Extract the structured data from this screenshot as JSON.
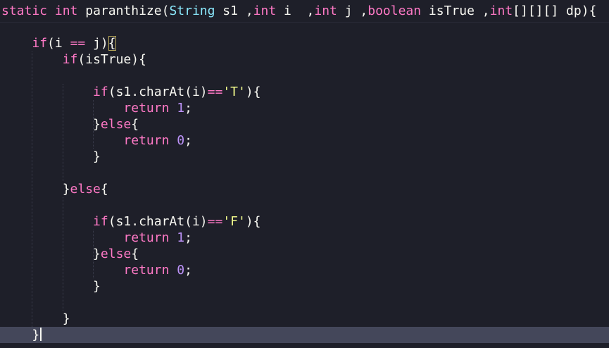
{
  "editor": {
    "theme_colors": {
      "background": "#1e1f29",
      "current_line": "#44475a",
      "keyword": "#ff79c6",
      "type": "#8be9fd",
      "number": "#bd93f9",
      "string": "#f1fa8c",
      "text": "#f8f8f2"
    },
    "current_line_index": 20,
    "lines": [
      {
        "tokens": [
          {
            "t": "kw",
            "v": "static"
          },
          {
            "t": "plain",
            "v": " "
          },
          {
            "t": "kw",
            "v": "int"
          },
          {
            "t": "plain",
            "v": " paranthize("
          },
          {
            "t": "type",
            "v": "String"
          },
          {
            "t": "plain",
            "v": " s1 ,"
          },
          {
            "t": "kw",
            "v": "int"
          },
          {
            "t": "plain",
            "v": " i  ,"
          },
          {
            "t": "kw",
            "v": "int"
          },
          {
            "t": "plain",
            "v": " j ,"
          },
          {
            "t": "kw",
            "v": "boolean"
          },
          {
            "t": "plain",
            "v": " isTrue ,"
          },
          {
            "t": "kw",
            "v": "int"
          },
          {
            "t": "plain",
            "v": "[][][] dp){"
          }
        ]
      },
      {
        "tokens": []
      },
      {
        "tokens": [
          {
            "t": "plain",
            "v": "    "
          },
          {
            "t": "kw",
            "v": "if"
          },
          {
            "t": "plain",
            "v": "(i "
          },
          {
            "t": "op",
            "v": "=="
          },
          {
            "t": "plain",
            "v": " j)"
          },
          {
            "t": "bracket-hl",
            "v": "{"
          }
        ]
      },
      {
        "tokens": [
          {
            "t": "plain",
            "v": "        "
          },
          {
            "t": "kw",
            "v": "if"
          },
          {
            "t": "plain",
            "v": "(isTrue){"
          }
        ]
      },
      {
        "tokens": []
      },
      {
        "tokens": [
          {
            "t": "plain",
            "v": "            "
          },
          {
            "t": "kw",
            "v": "if"
          },
          {
            "t": "plain",
            "v": "(s1.charAt(i)"
          },
          {
            "t": "op",
            "v": "=="
          },
          {
            "t": "str",
            "v": "'T'"
          },
          {
            "t": "plain",
            "v": "){"
          }
        ]
      },
      {
        "tokens": [
          {
            "t": "plain",
            "v": "                "
          },
          {
            "t": "kw",
            "v": "return"
          },
          {
            "t": "plain",
            "v": " "
          },
          {
            "t": "num",
            "v": "1"
          },
          {
            "t": "plain",
            "v": ";"
          }
        ]
      },
      {
        "tokens": [
          {
            "t": "plain",
            "v": "            }"
          },
          {
            "t": "kw",
            "v": "else"
          },
          {
            "t": "plain",
            "v": "{"
          }
        ]
      },
      {
        "tokens": [
          {
            "t": "plain",
            "v": "                "
          },
          {
            "t": "kw",
            "v": "return"
          },
          {
            "t": "plain",
            "v": " "
          },
          {
            "t": "num",
            "v": "0"
          },
          {
            "t": "plain",
            "v": ";"
          }
        ]
      },
      {
        "tokens": [
          {
            "t": "plain",
            "v": "            }"
          }
        ]
      },
      {
        "tokens": []
      },
      {
        "tokens": [
          {
            "t": "plain",
            "v": "        }"
          },
          {
            "t": "kw",
            "v": "else"
          },
          {
            "t": "plain",
            "v": "{"
          }
        ]
      },
      {
        "tokens": []
      },
      {
        "tokens": [
          {
            "t": "plain",
            "v": "            "
          },
          {
            "t": "kw",
            "v": "if"
          },
          {
            "t": "plain",
            "v": "(s1.charAt(i)"
          },
          {
            "t": "op",
            "v": "=="
          },
          {
            "t": "str",
            "v": "'F'"
          },
          {
            "t": "plain",
            "v": "){"
          }
        ]
      },
      {
        "tokens": [
          {
            "t": "plain",
            "v": "                "
          },
          {
            "t": "kw",
            "v": "return"
          },
          {
            "t": "plain",
            "v": " "
          },
          {
            "t": "num",
            "v": "1"
          },
          {
            "t": "plain",
            "v": ";"
          }
        ]
      },
      {
        "tokens": [
          {
            "t": "plain",
            "v": "            }"
          },
          {
            "t": "kw",
            "v": "else"
          },
          {
            "t": "plain",
            "v": "{"
          }
        ]
      },
      {
        "tokens": [
          {
            "t": "plain",
            "v": "                "
          },
          {
            "t": "kw",
            "v": "return"
          },
          {
            "t": "plain",
            "v": " "
          },
          {
            "t": "num",
            "v": "0"
          },
          {
            "t": "plain",
            "v": ";"
          }
        ]
      },
      {
        "tokens": [
          {
            "t": "plain",
            "v": "            }"
          }
        ]
      },
      {
        "tokens": []
      },
      {
        "tokens": [
          {
            "t": "plain",
            "v": "        }"
          }
        ]
      },
      {
        "tokens": [
          {
            "t": "plain",
            "v": "    }"
          }
        ]
      }
    ]
  }
}
